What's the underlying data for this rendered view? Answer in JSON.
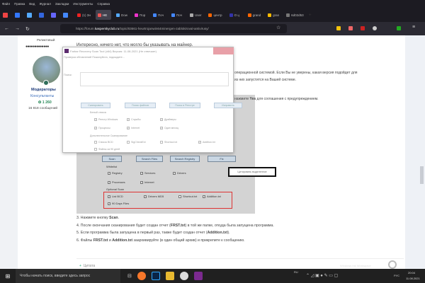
{
  "browser": {
    "menu": [
      "Файл",
      "Правка",
      "Вид",
      "Журнал",
      "Закладки",
      "Инструменты",
      "Справка"
    ],
    "tabs": [
      {
        "label": "(1) Зн",
        "color": "#e22"
      },
      {
        "label": "HЕ",
        "color": "#e55",
        "active": true
      },
      {
        "label": "Dow",
        "color": "#5af"
      },
      {
        "label": "Пор",
        "color": "#e3c"
      },
      {
        "label": "Поч",
        "color": "#48f"
      },
      {
        "label": "Поч",
        "color": "#48f"
      },
      {
        "label": "User",
        "color": "#aaa"
      },
      {
        "label": "центр",
        "color": "#f60"
      },
      {
        "label": "О ц",
        "color": "#33a"
      },
      {
        "label": "grand",
        "color": "#f60"
      },
      {
        "label": "gran",
        "color": "#fb0"
      },
      {
        "label": "6d02d53",
        "color": "#777"
      }
    ],
    "url_prefix": "https://forum.",
    "url_domain": "kasperskyclub.ru",
    "url_path": "/topic/83661-heurtrojanwin64minergen-zablokiroval-antivirusy/"
  },
  "post": {
    "rank": "Реликтовый",
    "quote": "Интересно, ничего нет, что могло бы указывать на майнер.",
    "group": "Модераторы",
    "role": "Консультанты",
    "reputation": "1 260",
    "messages": "16 818 сообщений",
    "text1": "операционной системой. Если Вы не уверены, какая версия подойдет для",
    "text2": "из них запустится на Вашей системе.",
    "text3_pre": "нажмите ",
    "text3_bold": "Yes",
    "text3_post": " для соглашения с предупреждением.",
    "steps": [
      {
        "pre": "3. Нажмите кнопку ",
        "b1": "Scan",
        "mid": ".",
        "b2": "",
        "post": ""
      },
      {
        "pre": "4. После окончания сканирования будет создан отчет (",
        "b1": "FRST.txt",
        "mid": ") в той же папке, откуда была запущена программа.",
        "b2": "",
        "post": ""
      },
      {
        "pre": "5. Если программа была запущена в первый раз, также будет создан отчет (",
        "b1": "Addition.txt",
        "mid": ").",
        "b2": "",
        "post": ""
      },
      {
        "pre": "6. Файлы ",
        "b1": "FRST.txt",
        "mid": " и ",
        "b2": "Addition.txt",
        "post": " заархивируйте (в один общий архив) и прикрепите к сообщению."
      }
    ],
    "quote_button": "Цитата",
    "tooltip": "Цитировать выделенное",
    "watermark": "Windows Ink Workspace"
  },
  "dialog": {
    "title": "Farbar Recovery Scan Tool (x64) Версия: 11-08-2021 (Не отвечает)",
    "status": "Проверка обновлений Пожалуйста, подождите...",
    "search_label": "Поиск:",
    "buttons": [
      "Сканировать",
      "Поиск файлов",
      "Поиск в Реестре",
      "Исправить"
    ],
    "whitelist": "Белый список",
    "wl": [
      "Реестр Windows",
      "Службы",
      "Драйверы",
      "Процессы",
      "Internet",
      "Один месяц"
    ],
    "optional": "Дополнительное Сканирование",
    "opt": [
      {
        "l": "Список BCD",
        "c": false
      },
      {
        "l": "SigCheckExt",
        "c": false
      },
      {
        "l": "Shortcut.txt",
        "c": false
      },
      {
        "l": "Addition.txt",
        "c": true
      },
      {
        "l": "Файлы за 90 дней",
        "c": false
      }
    ]
  },
  "screenshot": {
    "buttons": [
      "Scan",
      "Search Files",
      "Search Registry",
      "Fix"
    ],
    "whitelist": "Whitelist",
    "wl": [
      "Registry",
      "Services",
      "Drivers",
      "Processes",
      "Internet"
    ],
    "optional": "Optional Scan",
    "opt": [
      {
        "l": "List BCD",
        "c": true
      },
      {
        "l": "Drivers MD5",
        "c": true
      },
      {
        "l": "Shortcut.txt",
        "c": false
      },
      {
        "l": "Addition.txt",
        "c": true
      },
      {
        "l": "90 Days Files",
        "c": true
      }
    ]
  },
  "taskbar": {
    "search": "Чтобы начать поиск, введите здесь запрос",
    "lang_small": "RU",
    "lang": "РУС",
    "time": "20:04",
    "date": "11.08.2021"
  }
}
